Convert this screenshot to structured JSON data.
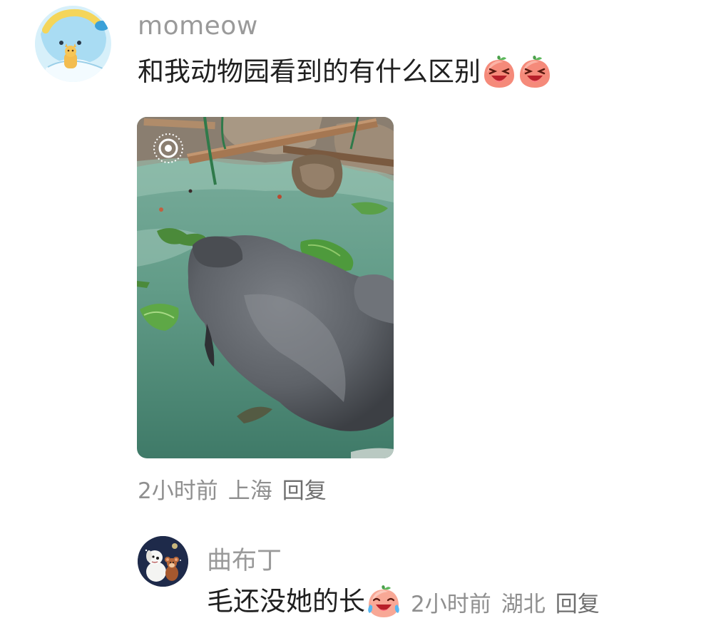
{
  "comment": {
    "username": "momeow",
    "text": "和我动物园看到的有什么区别",
    "emojis": [
      "laughing-peach-icon",
      "laughing-peach-icon"
    ],
    "meta": {
      "time": "2小时前",
      "location": "上海",
      "reply_label": "回复"
    }
  },
  "reply": {
    "username": "曲布丁",
    "text": "毛还没她的长",
    "emoji": "crying-laughing-peach-icon",
    "meta": {
      "time": "2小时前",
      "location": "湖北",
      "reply_label": "回复"
    }
  },
  "colors": {
    "username": "#9a9a9a",
    "text": "#1f1f1f",
    "meta": "#8f8f8f",
    "water": "#5f9a86"
  }
}
